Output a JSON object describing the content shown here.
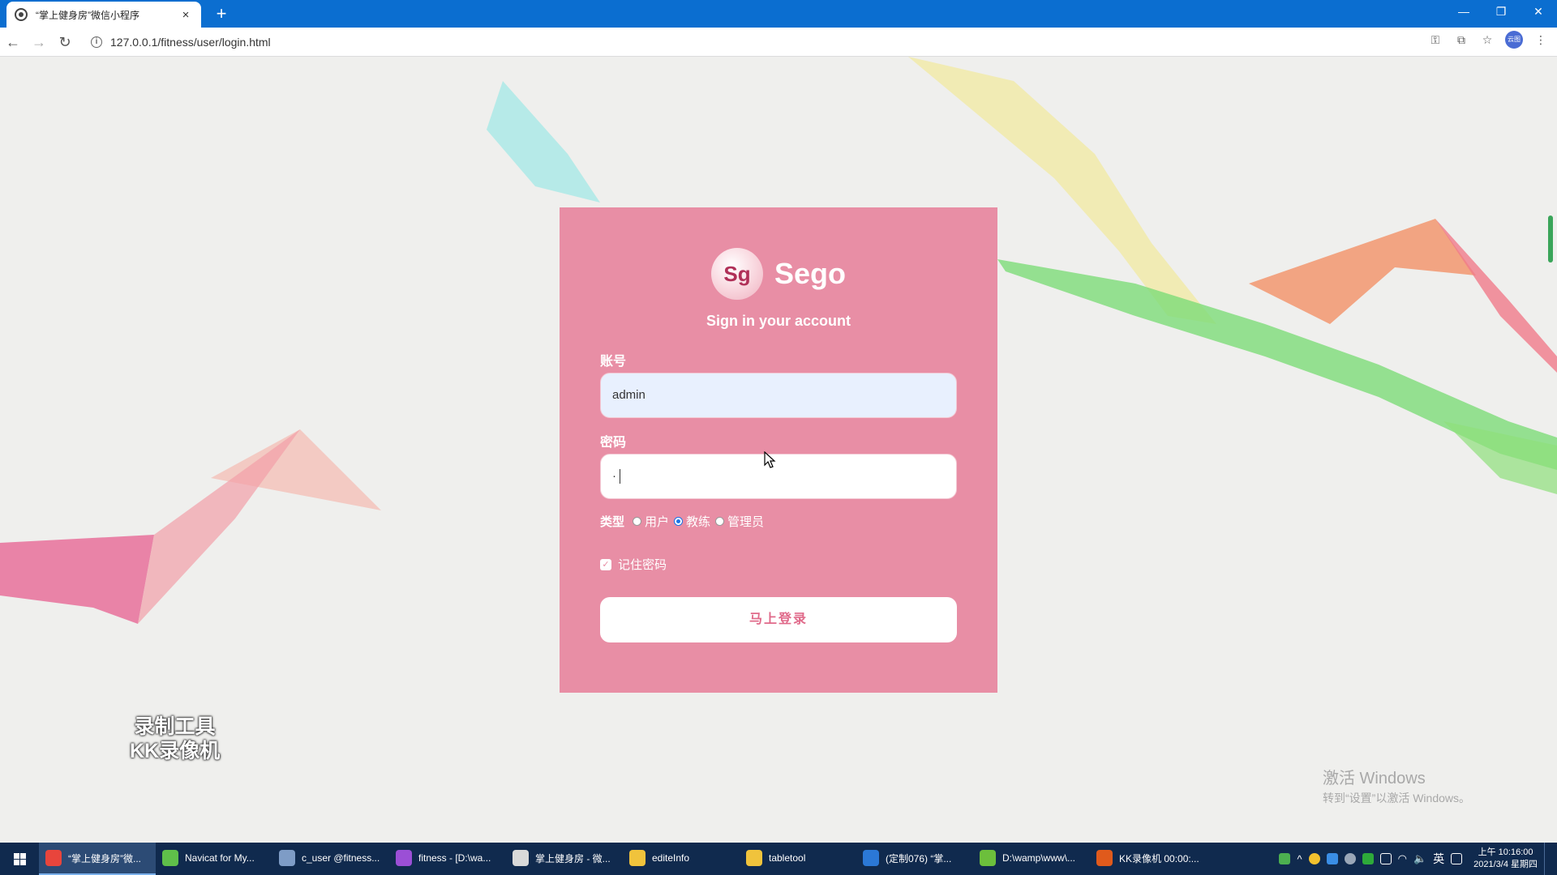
{
  "browser": {
    "tab_title": "“掌上健身房”微信小程序",
    "tab_close": "×",
    "new_tab": "+",
    "url": "127.0.0.1/fitness/user/login.html",
    "profile_label": "云图",
    "window_controls": {
      "minimize": "—",
      "restore": "❐",
      "close": "✕"
    }
  },
  "login": {
    "logo_text": "Sg",
    "brand": "Sego",
    "subtitle": "Sign in your account",
    "account_label": "账号",
    "account_value": "admin",
    "password_label": "密码",
    "password_value": "·",
    "type_label": "类型",
    "types": [
      {
        "label": "用户",
        "checked": false
      },
      {
        "label": "教练",
        "checked": true
      },
      {
        "label": "管理员",
        "checked": false
      }
    ],
    "remember_label": "记住密码",
    "remember_checked": true,
    "submit_label": "马上登录"
  },
  "overlay": {
    "watermark_line1": "录制工具",
    "watermark_line2": "KK录像机",
    "activate_title": "激活 Windows",
    "activate_sub": "转到“设置”以激活 Windows。"
  },
  "taskbar": {
    "items": [
      {
        "label": "“掌上健身房”微...",
        "icon": "chrome-icon",
        "color": "#e8453c",
        "active": true
      },
      {
        "label": "Navicat for My...",
        "icon": "navicat-icon",
        "color": "#5fbf4a",
        "active": false
      },
      {
        "label": "c_user @fitness...",
        "icon": "table-icon",
        "color": "#7e9cc6",
        "active": false
      },
      {
        "label": "fitness - [D:\\wa...",
        "icon": "phpstorm-icon",
        "color": "#9b4fd6",
        "active": false
      },
      {
        "label": "掌上健身房 - 微...",
        "icon": "wechat-devtools-icon",
        "color": "#d9d9d9",
        "active": false
      },
      {
        "label": "editeInfo",
        "icon": "folder-icon",
        "color": "#f0c33c",
        "active": false
      },
      {
        "label": "tabletool",
        "icon": "folder-icon",
        "color": "#f0c33c",
        "active": false
      },
      {
        "label": "(定制076) “掌...",
        "icon": "word-icon",
        "color": "#2b78d6",
        "active": false
      },
      {
        "label": "D:\\wamp\\www\\...",
        "icon": "notepad-icon",
        "color": "#6cbf3c",
        "active": false
      },
      {
        "label": "KK录像机 00:00:...",
        "icon": "kk-recorder-icon",
        "color": "#e05a1c",
        "active": false
      }
    ],
    "tray_ime": "英",
    "clock_time": "上午 10:16:00",
    "clock_date": "2021/3/4 星期四"
  }
}
